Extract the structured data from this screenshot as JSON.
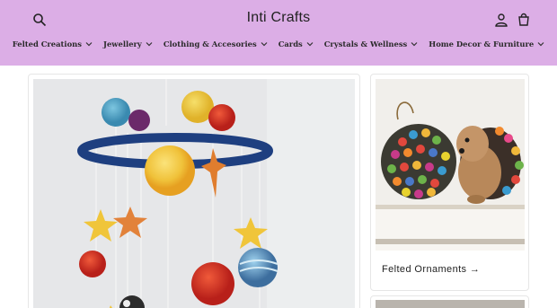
{
  "store": {
    "name": "Inti Crafts"
  },
  "header": {
    "background": "#dcaee6",
    "icons": [
      "search-icon",
      "account-icon",
      "cart-icon"
    ]
  },
  "nav": {
    "items": [
      {
        "label": "Felted Creations"
      },
      {
        "label": "Jewellery"
      },
      {
        "label": "Clothing & Accesories"
      },
      {
        "label": "Cards"
      },
      {
        "label": "Crystals & Wellness"
      },
      {
        "label": "Home Decor & Furniture"
      }
    ]
  },
  "collections": {
    "side_card_title": "Felted Ornaments →"
  }
}
